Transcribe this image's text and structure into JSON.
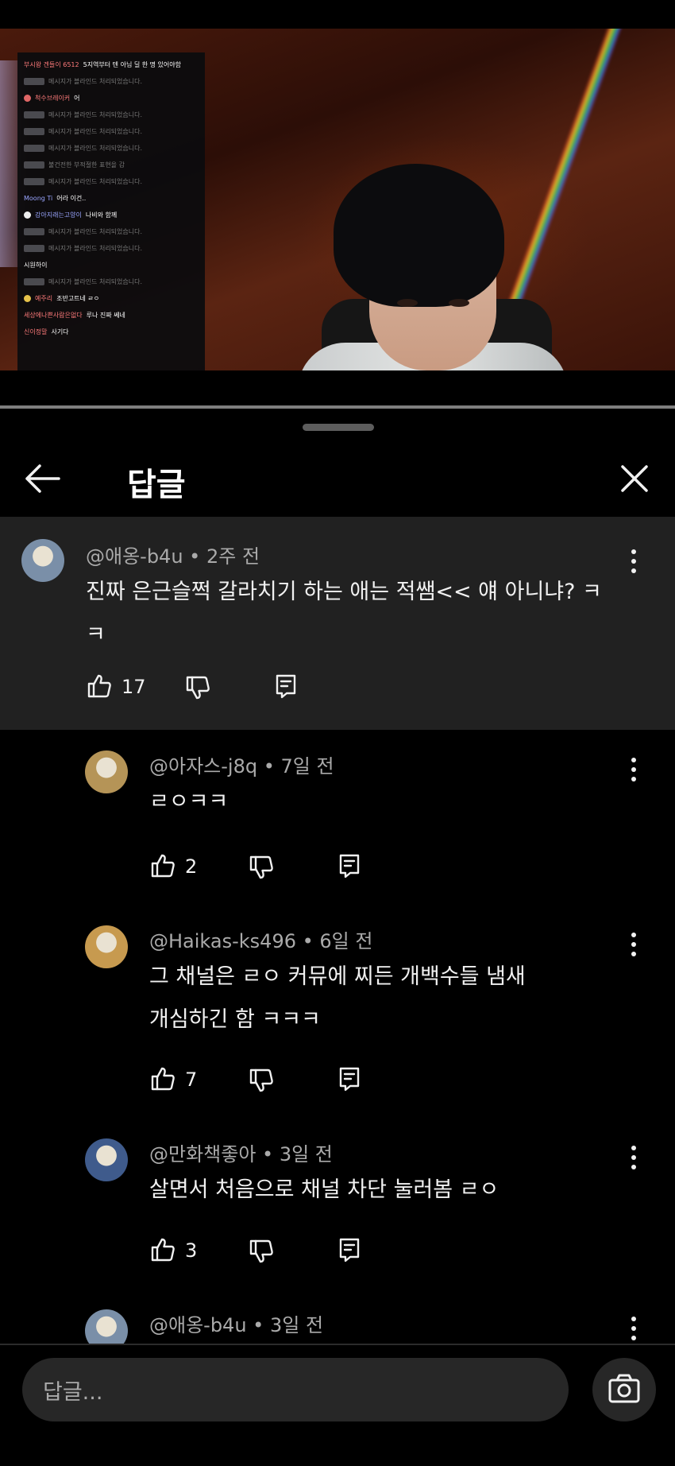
{
  "video": {
    "chat_lines": [
      {
        "name": "부시왕 겐들이 6512",
        "message": "5지역부터 텐 아님 딜 한 명 있어야함",
        "kind": "named"
      },
      {
        "name": "",
        "message": "메시지가 블라인드 처리되었습니다.",
        "kind": "blind"
      },
      {
        "name": "척수브레이커",
        "message": "어",
        "kind": "named"
      },
      {
        "name": "",
        "message": "메시지가 블라인드 처리되었습니다.",
        "kind": "blind"
      },
      {
        "name": "",
        "message": "메시지가 블라인드 처리되었습니다.",
        "kind": "blind"
      },
      {
        "name": "",
        "message": "메시지가 블라인드 처리되었습니다.",
        "kind": "blind"
      },
      {
        "name": "",
        "message": "불건전한 부적절한 표현을 감",
        "kind": "blind"
      },
      {
        "name": "",
        "message": "메시지가 블라인드 처리되었습니다.",
        "kind": "blind"
      },
      {
        "name": "Moong Ti",
        "message": "어라 이건..",
        "kind": "named"
      },
      {
        "name": "강아지래는고양이",
        "message": "나비와 함께",
        "kind": "named"
      },
      {
        "name": "",
        "message": "메시지가 블라인드 처리되었습니다.",
        "kind": "blind"
      },
      {
        "name": "",
        "message": "메시지가 블라인드 처리되었습니다.",
        "kind": "blind"
      },
      {
        "name": "",
        "message": "시원하이",
        "kind": "plain"
      },
      {
        "name": "",
        "message": "메시지가 블라인드 처리되었습니다.",
        "kind": "blind"
      },
      {
        "name": "예주리",
        "message": "조반고트네 ㄹㅇ",
        "kind": "named"
      },
      {
        "name": "세상에나쁜사람은없다",
        "message": "루나 진짜 쎄네",
        "kind": "named"
      },
      {
        "name": "신이정말",
        "message": "사기다",
        "kind": "named"
      }
    ]
  },
  "sheet": {
    "title": "답글",
    "back_icon": "arrow-left-icon",
    "close_icon": "close-icon"
  },
  "comments": [
    {
      "author": "@애옹-b4u",
      "time": "2주 전",
      "text_lines": [
        "진짜 은근슬쩍 갈라치기 하는 애는 적쌤<< 얘 아니냐? ㅋ",
        "ㅋ"
      ],
      "likes": "17",
      "avatar_color": "#7a8fa8"
    },
    {
      "author": "@아자스-j8q",
      "time": "7일 전",
      "text_lines": [
        "ㄹㅇㅋㅋ"
      ],
      "likes": "2",
      "avatar_color": "#b59457"
    },
    {
      "author": "@Haikas-ks496",
      "time": "6일 전",
      "text_lines": [
        "그 채널은 ㄹㅇ 커뮤에 찌든 개백수들 냄새",
        "개심하긴 함 ㅋㅋㅋ"
      ],
      "likes": "7",
      "avatar_color": "#c79a4f"
    },
    {
      "author": "@만화책좋아",
      "time": "3일 전",
      "text_lines": [
        "살면서 처음으로 채널 차단 눌러봄 ㄹㅇ"
      ],
      "likes": "3",
      "avatar_color": "#3f5b8c"
    },
    {
      "author": "@애옹-b4u",
      "time": "3일 전",
      "text_lines": [],
      "likes": "",
      "avatar_color": "#7a8fa8"
    }
  ],
  "reply_bar": {
    "placeholder": "답글...",
    "camera_icon": "camera-icon"
  }
}
